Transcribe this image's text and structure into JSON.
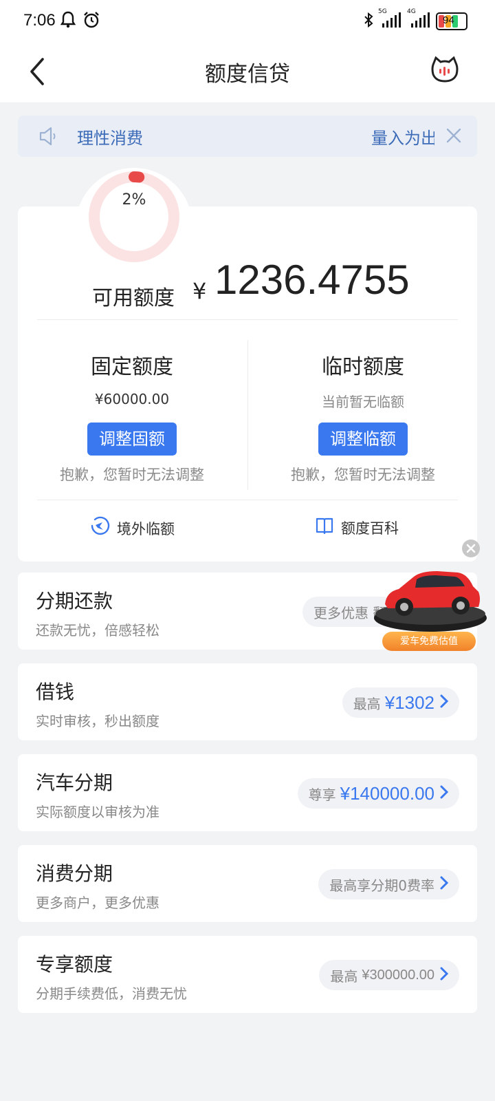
{
  "status_bar": {
    "time": "7:06",
    "battery": "94",
    "network_1": "5G",
    "network_2": "4G"
  },
  "nav": {
    "title": "额度信贷"
  },
  "notice": {
    "text1": "理性消费",
    "text2": "量入为出"
  },
  "credit": {
    "usage_percent": 2,
    "usage_label": "2%",
    "available_label": "可用额度",
    "currency": "¥",
    "available_amount": "1236.4755",
    "fixed": {
      "title": "固定额度",
      "amount": "¥60000.00",
      "button": "调整固额",
      "note": "抱歉，您暂时无法调整"
    },
    "temp": {
      "title": "临时额度",
      "amount": "当前暂无临额",
      "button": "调整临额",
      "note": "抱歉，您暂时无法调整"
    },
    "quick_links": {
      "overseas": "境外临额",
      "encyclopedia": "额度百科"
    }
  },
  "services": [
    {
      "title": "分期还款",
      "subtitle": "还款无忧，倍感轻松",
      "pill_label": "更多优惠 翻",
      "pill_value": ""
    },
    {
      "title": "借钱",
      "subtitle": "实时审核，秒出额度",
      "pill_label": "最高",
      "pill_value": "¥1302"
    },
    {
      "title": "汽车分期",
      "subtitle": "实际额度以审核为准",
      "pill_label": "尊享",
      "pill_value": "¥140000.00"
    },
    {
      "title": "消费分期",
      "subtitle": "更多商户，更多优惠",
      "pill_label": "最高享分期0费率",
      "pill_value": ""
    },
    {
      "title": "专享额度",
      "subtitle": "分期手续费低，消费无忧",
      "pill_label": "最高",
      "pill_value": "¥300000.00"
    }
  ],
  "car_promo": {
    "badge": "爱车免费估值"
  },
  "colors": {
    "accent": "#3a78ef",
    "ring_track": "#fbe3e3",
    "ring_fill": "#e84a4a",
    "notice_bg": "#e9eef6"
  }
}
